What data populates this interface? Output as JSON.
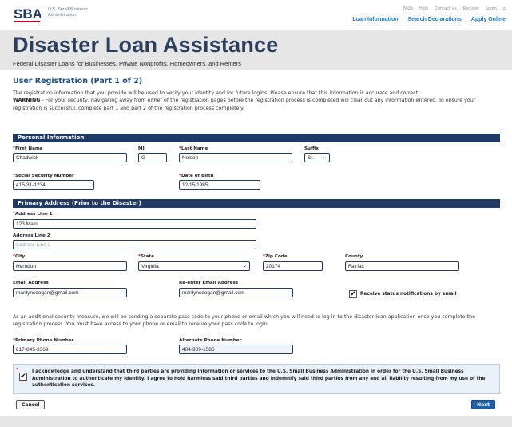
{
  "header": {
    "logo_text": "SBA",
    "agency_line1": "U.S. Small Business",
    "agency_line2": "Administration",
    "util_links": [
      "FAQs",
      "Help",
      "Contact Us",
      "Register",
      "Login"
    ],
    "main_links": [
      "Loan Information",
      "Search Declarations",
      "Apply Online"
    ]
  },
  "banner": {
    "title": "Disaster Loan Assistance",
    "subtitle": "Federal Disaster Loans for Businesses, Private Nonprofits, Homeowners, and Renters"
  },
  "page": {
    "title": "User Registration (Part 1 of 2)",
    "intro": "The registration information that you provide will be used to verify your identity and for future logins. Please ensure that this information is accurate and correct.",
    "warning_label": "WARNING",
    "warning_text": " - For your security, navigating away from either of the registration pages before the registration process is completed will clear out any information entered. To ensure your registration is successful, complete part 1 and part 2 of the registration process completely."
  },
  "personal": {
    "section_title": "Personal Information",
    "first_name_label": "First Name",
    "first_name": "Chadwick",
    "mi_label": "MI",
    "mi": "G",
    "last_name_label": "Last Name",
    "last_name": "Nelson",
    "suffix_label": "Suffix",
    "suffix": "Sr.",
    "ssn_label": "Social Security Number",
    "ssn": "415-31-1234",
    "dob_label": "Date of Birth",
    "dob": "12/15/1985",
    "required_mark": "*"
  },
  "address": {
    "section_title": "Primary Address (Prior to the Disaster)",
    "line1_label": "Address Line 1",
    "line1": "123 Main",
    "line2_label": "Address Line 2",
    "line2_placeholder": "Address Line 2",
    "city_label": "City",
    "city": "Herndon",
    "state_label": "State",
    "state": "Virginia",
    "zip_label": "Zip Code",
    "zip": "20174",
    "county_label": "County",
    "county": "Fairfax",
    "email_label": "Email Address",
    "email": "marilynsdogan@gmail.com",
    "reemail_label": "Re-enter Email Address",
    "reemail": "marilynsdogan@gmail.com",
    "notify_label": "Receive status notifications by email",
    "notify_checked": true
  },
  "security": {
    "text": "As an additional security measure, we will be sending a separate pass code to your phone or email which you will need to log in to the disaster loan application once you complete the registration process. You must have access to your phone or email to receive your pass code to login.",
    "primary_phone_label": "Primary Phone Number",
    "primary_phone": "817-845-3369",
    "alt_phone_label": "Alternate Phone Number",
    "alt_phone": "404-909-1585"
  },
  "ack": {
    "text": "I acknowledge and understand that third parties are providing information or services to the U.S. Small Business Administration in order for the U.S. Small Business Administration to authenticate my identity. I agree to hold harmless said third parties and indemnify said third parties from any and all liability resulting from my use of the authentication services.",
    "checked": true
  },
  "buttons": {
    "cancel": "Cancel",
    "next": "Next"
  },
  "colors": {
    "navy": "#1f3a66",
    "link_blue": "#1b76c4",
    "title_blue": "#1e4e87",
    "required_red": "#d0021b",
    "banner_gray": "#e6e6e6"
  }
}
